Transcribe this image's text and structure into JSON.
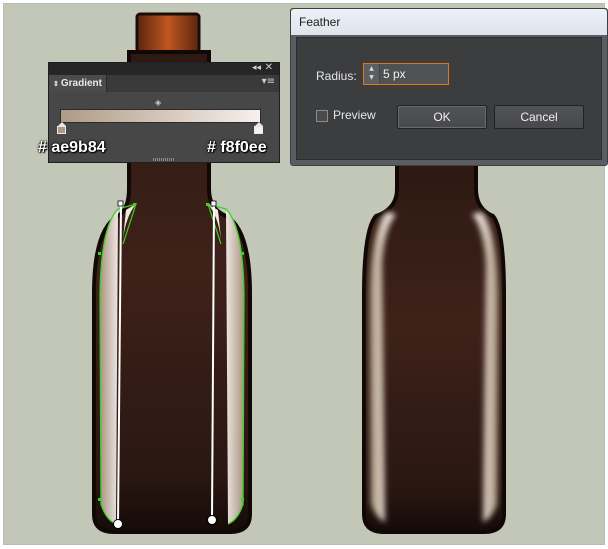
{
  "gradient_panel": {
    "tab_label": "Gradient",
    "tab_arrow_icon": "updown-arrows-icon",
    "collapse_glyph": "◂◂",
    "close_glyph": "✕",
    "menu_glyph": "▾≡",
    "midpoint_glyph": "◈",
    "stop_left_color": "#ae9b84",
    "stop_right_color": "#f8f0ee"
  },
  "hex_left": "# ae9b84",
  "hex_right": "# f8f0ee",
  "feather_dialog": {
    "title": "Feather",
    "radius_label": "Radius:",
    "radius_value": "5 px",
    "preview_label": "Preview",
    "preview_checked": false,
    "ok_label": "OK",
    "cancel_label": "Cancel"
  },
  "colors": {
    "bottle_dark": "#241410",
    "bottle_mid": "#3c2119",
    "neck_amber": "#a5461c",
    "selection_green": "#3bd12a"
  }
}
